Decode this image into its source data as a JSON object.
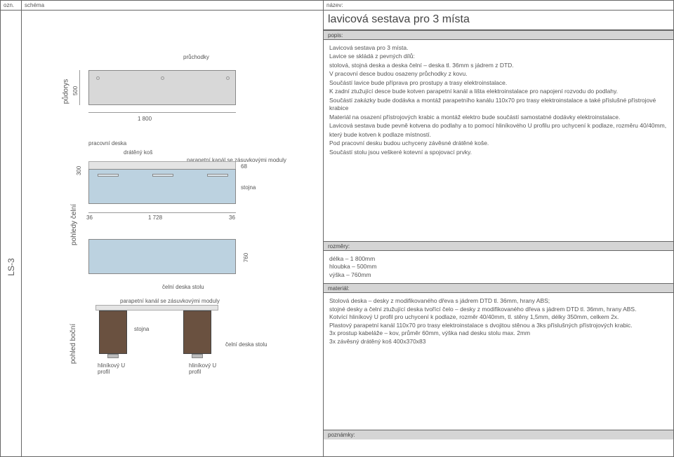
{
  "header": {
    "ozn": "ozn.",
    "schema": "schéma",
    "nazev_label": "název:",
    "nazev_value": "lavicová sestava pro 3 místa",
    "popis_label": "popis:"
  },
  "left": {
    "code": "LS-3",
    "vlabels": {
      "pudorys": "půdorys",
      "celni": "pohledy čelní",
      "bocni": "pohled boční"
    }
  },
  "dims": {
    "d500": "500",
    "d1800": "1 800",
    "d36a": "36",
    "d1728": "1 728",
    "d36b": "36",
    "d68": "68",
    "d300": "300",
    "d760": "760"
  },
  "labels": {
    "pruchodky": "průchodky",
    "pracovni_deska": "pracovní deska",
    "drateny_kos": "drátěný koš",
    "parapetni_kanal": "parapetní kanál se zásuvkovými moduly",
    "stojna": "stojna",
    "celni_deska": "čelní deska stolu",
    "hlinik_u": "hliníkový U\nprofil",
    "parapetni_kanal2": "parapetní kanál se zásuvkovými moduly",
    "stojna2": "stojna",
    "celni_deska2": "čelní deska stolu",
    "hlinik_u2": "hliníkový U\nprofil"
  },
  "popis": {
    "p1": "Lavicová sestava pro 3 místa.",
    "p2": "Lavice se skládá z pevných dílů:",
    "p3": "stolová, stojná deska a deska čelní – deska tl. 36mm s jádrem z DTD.",
    "p4": "V pracovní desce budou osazeny průchodky z kovu.",
    "p5": "Součástí lavice bude příprava pro prostupy a trasy elektroinstalace.",
    "p6": "K zadní ztužující desce bude kotven parapetní kanál a lišta elektroinstalace pro napojení rozvodu do podlahy.",
    "p7": "Součástí zakázky bude dodávka a montáž parapetního kanálu 110x70 pro trasy elektroinstalace a také příslušné přístrojové krabice",
    "p8": "Materiál na osazení přístrojových krabic a montáž elektro bude součástí samostatné dodávky elektroinstalace.",
    "p9": "Lavicová sestava bude pevně kotvena do podlahy a to pomocí hliníkového U profilu pro uchycení k podlaze, rozměru 40/40mm,",
    "p10": "který bude kotven k podlaze místností.",
    "p11": "Pod pracovní desku budou uchyceny závěsné drátěné koše.",
    "p12": "",
    "p13": "Součástí stolu jsou veškeré kotevní a spojovací prvky."
  },
  "rozmery": {
    "label": "rozměry:",
    "l1": "délka – 1 800mm",
    "l2": "hloubka – 500mm",
    "l3": "výška – 760mm"
  },
  "material": {
    "label": "materiál:",
    "m1": "Stolová deska – desky z modifikovaného dřeva s jádrem DTD tl. 36mm, hrany ABS;",
    "m2": "stojné desky a čelní ztužující deska tvořící čelo – desky z modifikovaného dřeva s jádrem DTD tl. 36mm, hrany ABS.",
    "m3": "Kotvící hliníkový U profil pro uchycení k podlaze, rozměr 40/40mm, tl. stěny 1,5mm, délky 350mm, celkem 2x.",
    "m4": "Plastový parapetní kanál 110x70 pro trasy elektroinstalace s dvojitou stěnou a 3ks příslušných přístrojových krabic.",
    "m5": "3x prostup kabeláže – kov, průměr 60mm, výška nad desku stolu max. 2mm",
    "m6": "3x závěsný drátěný koš 400x370x83"
  },
  "poznamky": {
    "label": "poznámky:"
  }
}
